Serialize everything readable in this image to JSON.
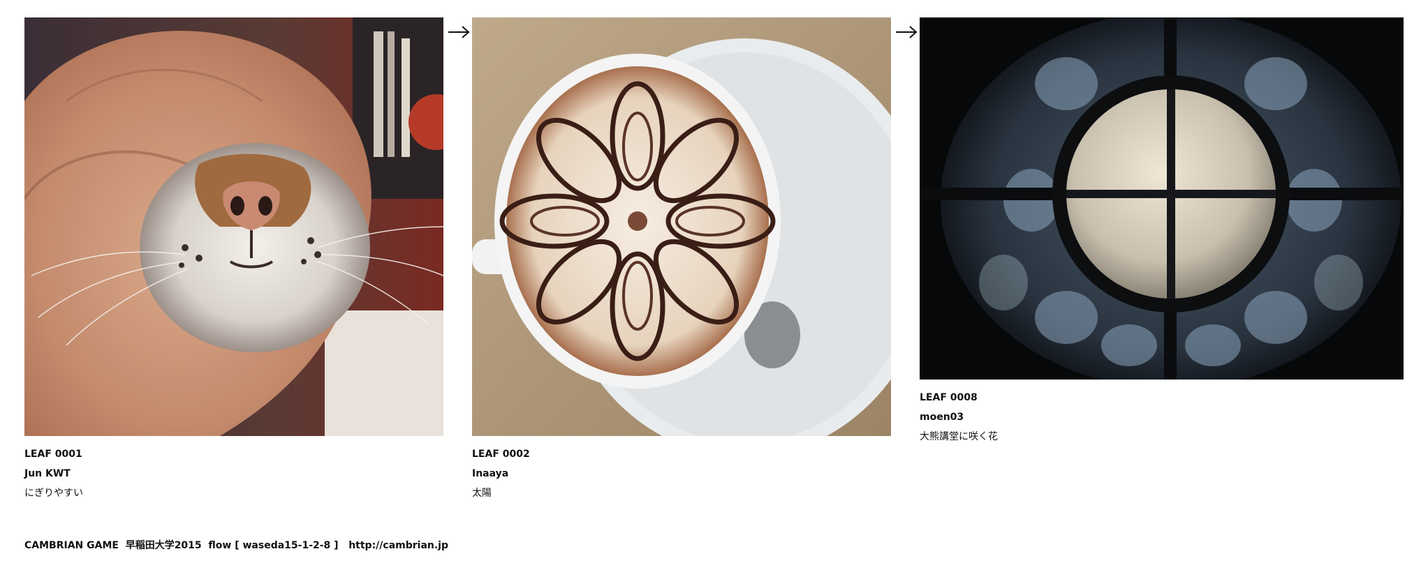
{
  "leaves": [
    {
      "leaf_no": "LEAF 0001",
      "author": "Jun KWT",
      "title": "にぎりやすい",
      "image_subject": "hand-holding-cat-face-photo"
    },
    {
      "leaf_no": "LEAF 0002",
      "author": "Inaaya",
      "title": "太陽",
      "image_subject": "latte-art-cup-photo"
    },
    {
      "leaf_no": "LEAF 0008",
      "author": "moen03",
      "title": "大熊講堂に咲く花",
      "image_subject": "round-window-photo"
    }
  ],
  "arrows": [
    "arrow-right-icon",
    "arrow-right-icon"
  ],
  "footer": {
    "text": "CAMBRIAN GAME  早稲田大学2015  flow [ waseda15-1-2-8 ]   http://cambrian.jp"
  }
}
